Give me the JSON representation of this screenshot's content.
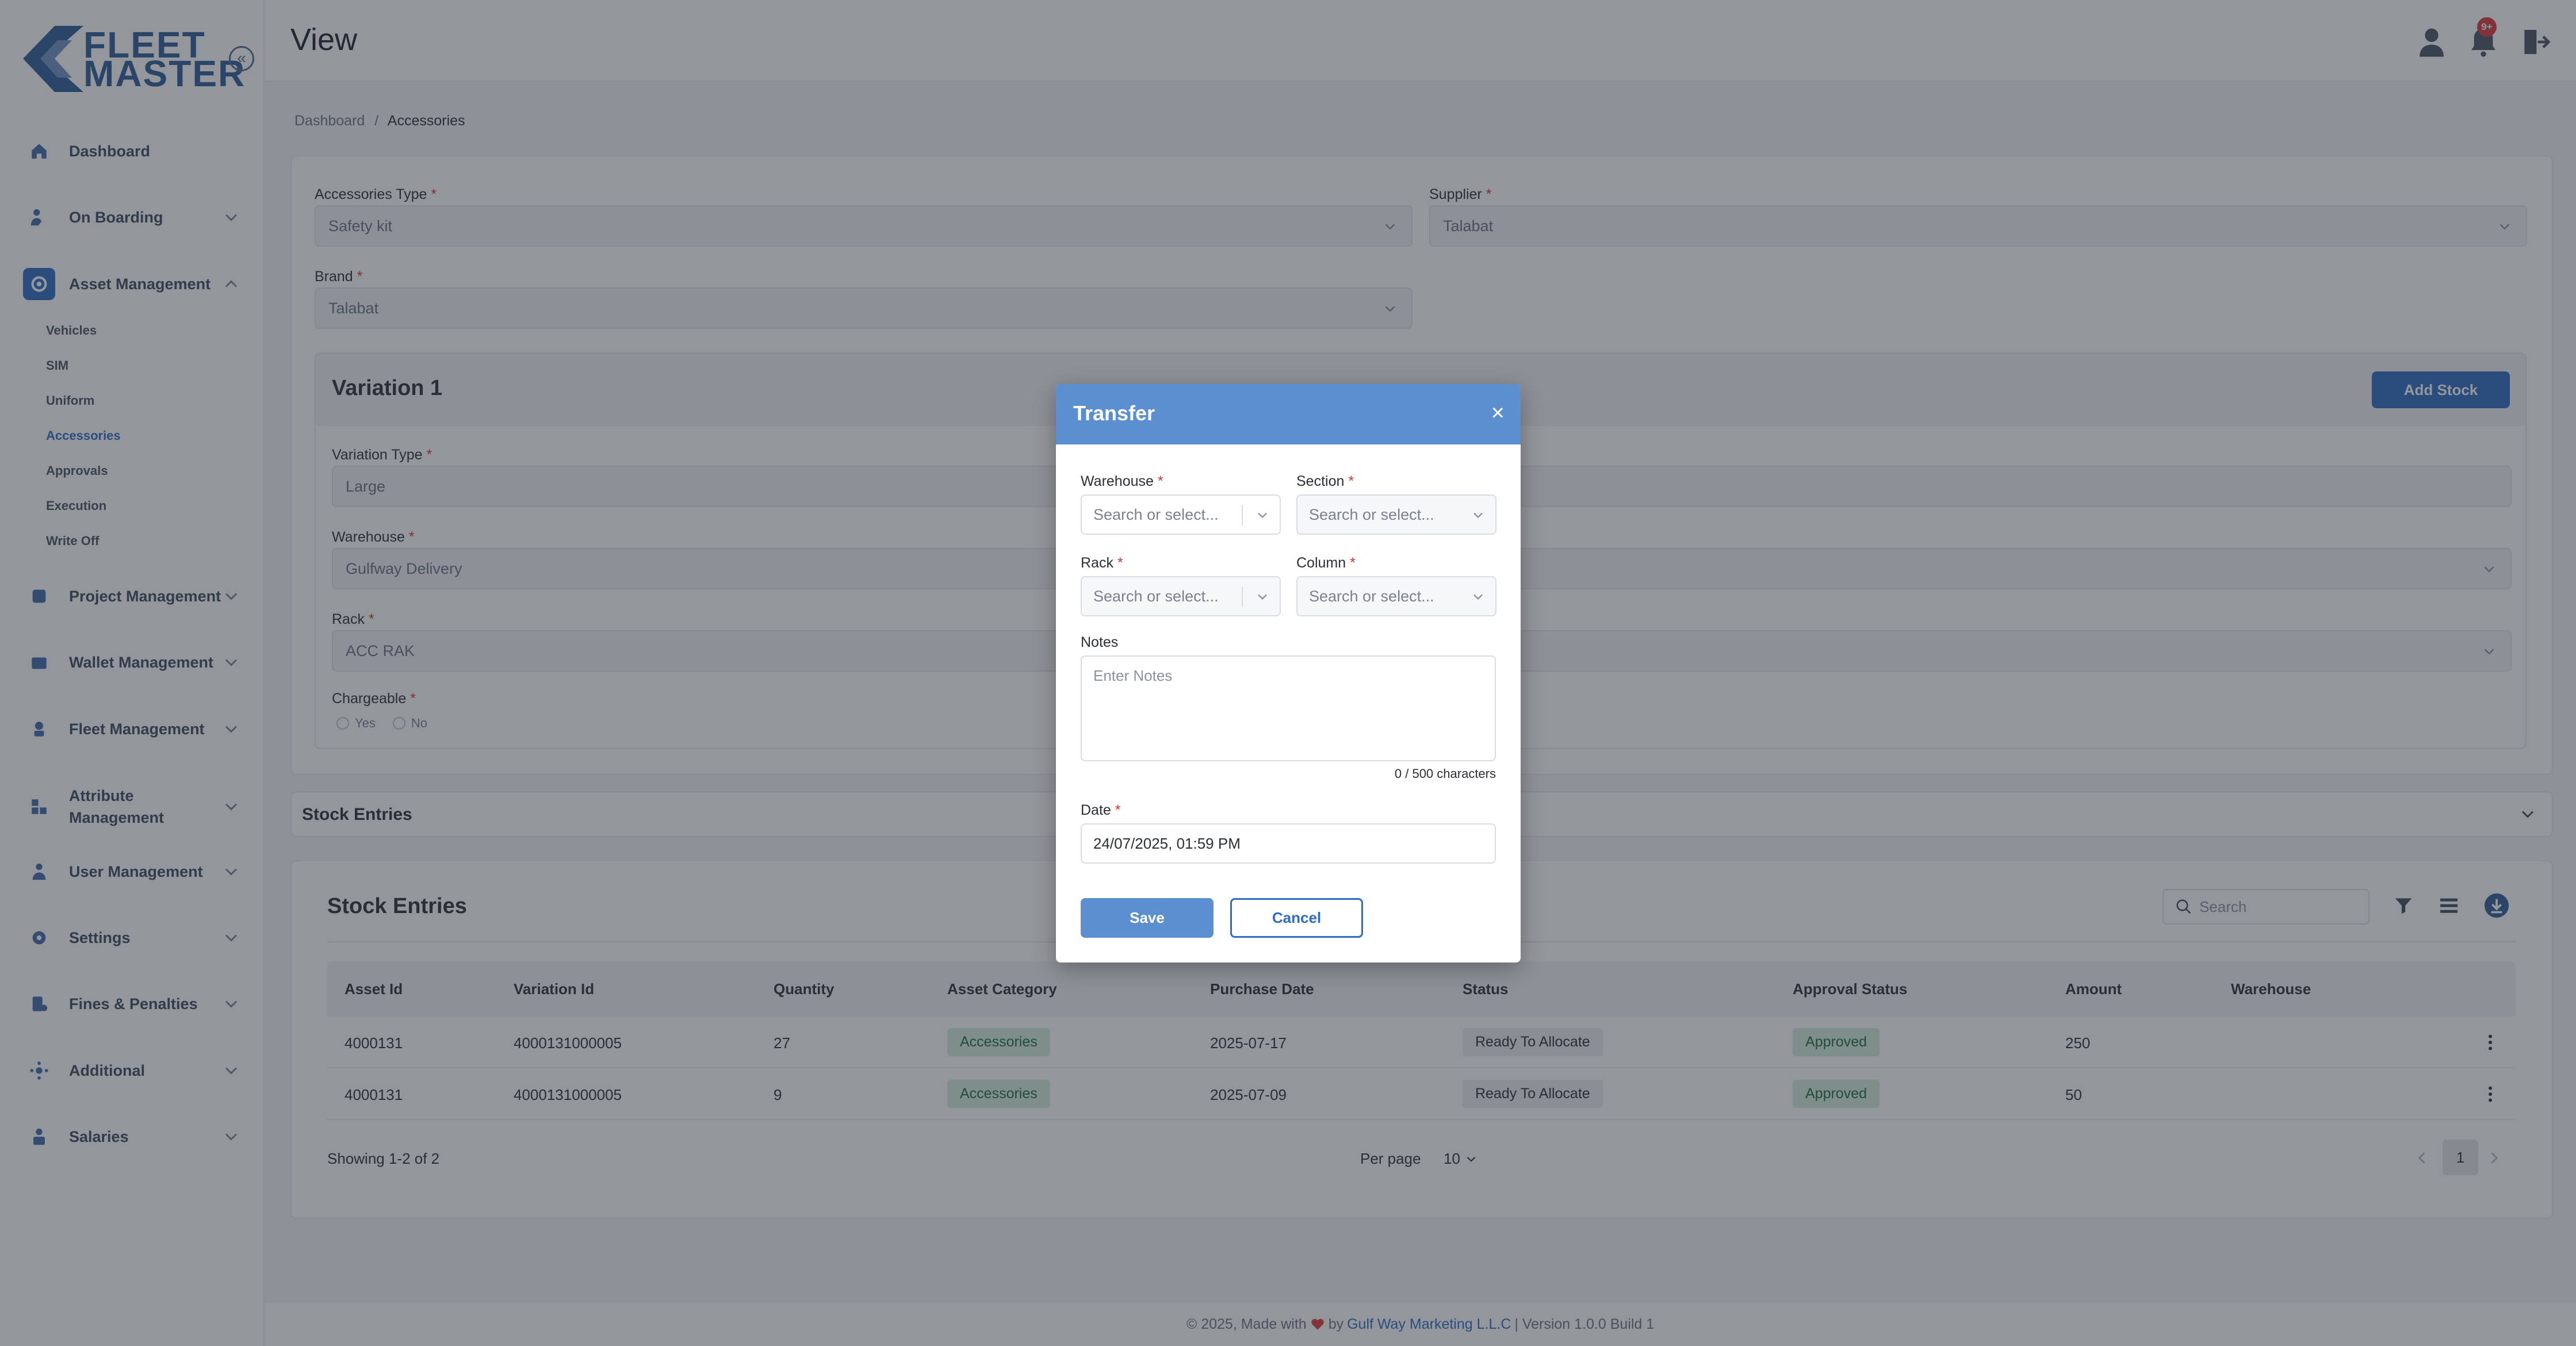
{
  "app": {
    "logo_line1": "FLEET",
    "logo_line2": "MASTER",
    "collapse_icon": "double-chevron-left-icon",
    "heart_icon": "heart-icon"
  },
  "header": {
    "title": "View",
    "notifications_badge": "9+"
  },
  "breadcrumb": {
    "root": "Dashboard",
    "separator": "/",
    "current": "Accessories"
  },
  "sidebar": {
    "items": [
      {
        "label": "Dashboard",
        "icon": "home-icon"
      },
      {
        "label": "On Boarding",
        "icon": "onboarding-icon"
      },
      {
        "label": "Asset Management",
        "icon": "asset-icon"
      },
      {
        "label": "Project Management",
        "icon": "project-icon"
      },
      {
        "label": "Wallet Management",
        "icon": "wallet-icon"
      },
      {
        "label": "Fleet Management",
        "icon": "fleet-icon"
      },
      {
        "label": "Attribute Management",
        "icon": "attribute-icon"
      },
      {
        "label": "User Management",
        "icon": "users-icon"
      },
      {
        "label": "Settings",
        "icon": "gear-icon"
      },
      {
        "label": "Fines & Penalties",
        "icon": "fines-icon"
      },
      {
        "label": "Additional",
        "icon": "additional-icon"
      },
      {
        "label": "Salaries",
        "icon": "salaries-icon"
      }
    ],
    "sub_items": [
      "Vehicles",
      "SIM",
      "Uniform",
      "Accessories",
      "Approvals",
      "Execution",
      "Write Off"
    ]
  },
  "form": {
    "accessories_type_label": "Accessories Type",
    "accessories_type_value": "Safety kit",
    "supplier_label": "Supplier",
    "supplier_value": "Talabat",
    "brand_label": "Brand",
    "brand_value": "Talabat",
    "required_mark": "*"
  },
  "variation": {
    "title": "Variation 1",
    "add_stock": "Add Stock",
    "variation_type_label": "Variation Type",
    "variation_type_value": "Large",
    "warehouse_label": "Warehouse",
    "warehouse_value": "Gulfway Delivery",
    "rack_label": "Rack",
    "rack_value": "ACC RAK",
    "chargeable_label": "Chargeable",
    "yes": "Yes",
    "no": "No"
  },
  "stock_section": {
    "collapse_title": "Stock Entries",
    "title": "Stock Entries",
    "search_placeholder": "Search"
  },
  "table": {
    "columns": [
      "Asset Id",
      "Variation Id",
      "Quantity",
      "Asset Category",
      "Purchase Date",
      "Status",
      "Approval Status",
      "Amount",
      "Warehouse"
    ],
    "rows": [
      {
        "asset_id": "4000131",
        "variation_id": "4000131000005",
        "quantity": "27",
        "category": "Accessories",
        "purchase_date": "2025-07-17",
        "status": "Ready To Allocate",
        "approval": "Approved",
        "amount": "250",
        "warehouse": ""
      },
      {
        "asset_id": "4000131",
        "variation_id": "4000131000005",
        "quantity": "9",
        "category": "Accessories",
        "purchase_date": "2025-07-09",
        "status": "Ready To Allocate",
        "approval": "Approved",
        "amount": "50",
        "warehouse": ""
      }
    ]
  },
  "pagination": {
    "showing": "Showing 1-2 of 2",
    "per_page_label": "Per page",
    "per_page_value": "10",
    "page": "1"
  },
  "modal": {
    "title": "Transfer",
    "close": "×",
    "warehouse_label": "Warehouse",
    "section_label": "Section",
    "rack_label": "Rack",
    "column_label": "Column",
    "select_placeholder": "Search or select...",
    "notes_label": "Notes",
    "notes_placeholder": "Enter Notes",
    "char_count": "0 / 500 characters",
    "date_label": "Date",
    "date_value": "24/07/2025, 01:59 PM",
    "save": "Save",
    "cancel": "Cancel"
  },
  "footer": {
    "prefix": "© 2025, Made with",
    "by": "by",
    "company": "Gulf Way Marketing L.L.C",
    "version": "| Version 1.0.0 Build 1"
  },
  "colors": {
    "primary": "#2f6cc4",
    "modal_header": "#5b8fd0",
    "approved_bg": "#d5eedd",
    "badge": "#d93a3a"
  }
}
